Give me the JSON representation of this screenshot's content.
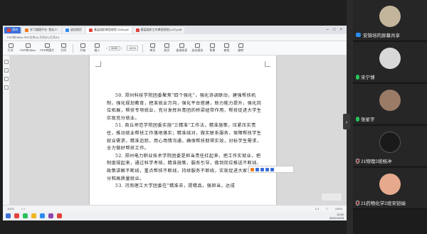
{
  "browser": {
    "tabs": [
      {
        "label": "郑州",
        "color": "#e0433c"
      },
      {
        "label": "学习强国平台 \"我达人\"",
        "color": "#f07b1f"
      },
      {
        "label": "返回首页",
        "color": "#2d8cf0"
      },
      {
        "label": "基层组织典型经验 2346.pdf",
        "color": "#e0433c"
      },
      {
        "label": "基层组织工作典型经验(1-67).pdf",
        "color": "#e0433c"
      }
    ],
    "address": "PDF转Office   PDF文件(1)    打印(P)   打开(P)"
  },
  "toolbar": {
    "buttons": [
      "打开",
      "PDF转Office",
      "PDF转图片",
      "打印",
      "开始",
      "插入",
      "批注",
      "编辑",
      "页面",
      "保护",
      "转换"
    ],
    "page_current": "11/20",
    "zoom": "100%",
    "view_buttons": [
      "单页",
      "双页",
      "连续阅读",
      "自动滚动",
      "背景",
      "查找",
      "旋转"
    ]
  },
  "document": {
    "paragraphs": [
      "50. 郑州科技学院团委聚焦\"四个强化\"，强化协调联动，建强帮扶机制，强化规划教育，把准就业方向，强化平台搭建，助力能力提升，强化岗位拓展，帮扶专项就业，充分发挥共青团的桥梁纽带作用，帮扶促进大学生实现充分就业。",
      "51. 商丘师范学院团委实施\"三精准\"工作法，精准施策，压紧压实责任，推动就业帮扶工作落地落实；精准结对，做实联系服务，保障帮扶学生就业需求，精准追踪，用心用情沟通，确保帮扶取得实效，对标学生需求，全力做好帮扶工作。",
      "52. 郑州电力职业技术学院团委是担当责任扛起来，把工作实就业，把制度规起来，通过科学考核，精准施策，服务引导，做到岗位推送不断线、政策讲解不断线，重点帮扶不断线，持续服务不断线，实现促进大家学生充分和高质量就业。",
      "53. 河南理工大学团委在\"精准去，提精品，强担当，达成"
    ]
  },
  "status_bar": {
    "page": "11/20",
    "items": [
      "< >",
      "1:1",
      "□",
      "100%"
    ]
  },
  "taskbar": {
    "time": "12:52",
    "date": "2022/12/23"
  },
  "watermark_button": "",
  "participants": [
    {
      "name": "安锦培的屏幕共享",
      "mic": "screen",
      "avatar_color": "#c2b59b"
    },
    {
      "name": "宋宁博",
      "mic": "active",
      "avatar_color": "#d8d8d8"
    },
    {
      "name": "张星宇",
      "mic": "active",
      "avatar_color": "#9a7b66"
    },
    {
      "name": "21物理2班杨冲",
      "mic": "muted",
      "avatar_color": "#1a1a1a"
    },
    {
      "name": "21药物化学2班宋铠瑜",
      "mic": "muted",
      "avatar_color": "#e6a98e"
    }
  ],
  "colors": {
    "accent": "#2d8cf0",
    "mic_active": "#27c05a",
    "mic_muted": "#e0433c"
  }
}
